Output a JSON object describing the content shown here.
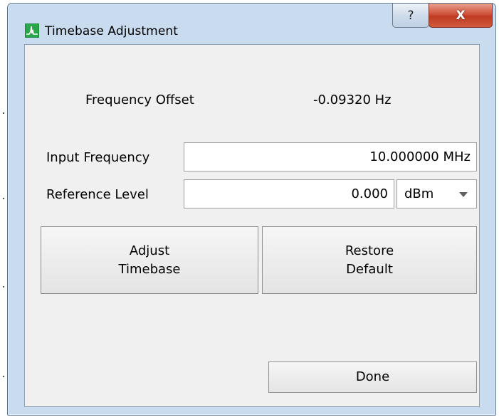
{
  "window": {
    "title": "Timebase Adjustment",
    "help_label": "?",
    "close_label": "X"
  },
  "frequency_offset": {
    "label": "Frequency Offset",
    "value": "-0.09320 Hz"
  },
  "input_frequency": {
    "label": "Input Frequency",
    "value": "10.000000 MHz"
  },
  "reference_level": {
    "label": "Reference Level",
    "value": "0.000",
    "unit_selected": "dBm"
  },
  "buttons": {
    "adjust_line1": "Adjust",
    "adjust_line2": "Timebase",
    "restore_line1": "Restore",
    "restore_line2": "Default",
    "done": "Done"
  },
  "colors": {
    "window_frame": "#c9dcef",
    "close_button": "#c8432a",
    "app_icon": "#1e8a3c"
  },
  "icons": {
    "app": "spectrum-waveform-icon",
    "help": "question-mark-icon",
    "close": "close-x-icon",
    "dropdown": "chevron-down-icon"
  }
}
